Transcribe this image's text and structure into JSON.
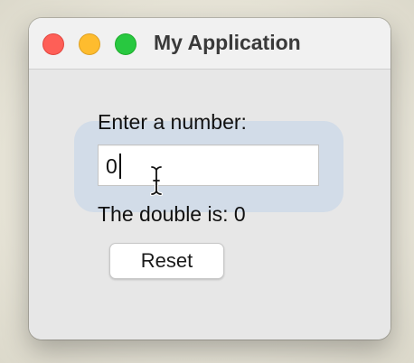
{
  "window": {
    "title": "My Application",
    "controls": {
      "close": {
        "icon": "close-traffic-light",
        "color": "#fe5f57"
      },
      "minimize": {
        "icon": "minimize-traffic-light",
        "color": "#febc2e"
      },
      "zoom": {
        "icon": "zoom-traffic-light",
        "color": "#28c840"
      }
    }
  },
  "form": {
    "prompt_label": "Enter a number:",
    "number_input": {
      "value": "0",
      "focused": true,
      "focus_color": "#d2dce8"
    },
    "result_label": "The double is: 0",
    "reset_label": "Reset"
  },
  "cursor": {
    "icon": "ibeam-cursor"
  }
}
